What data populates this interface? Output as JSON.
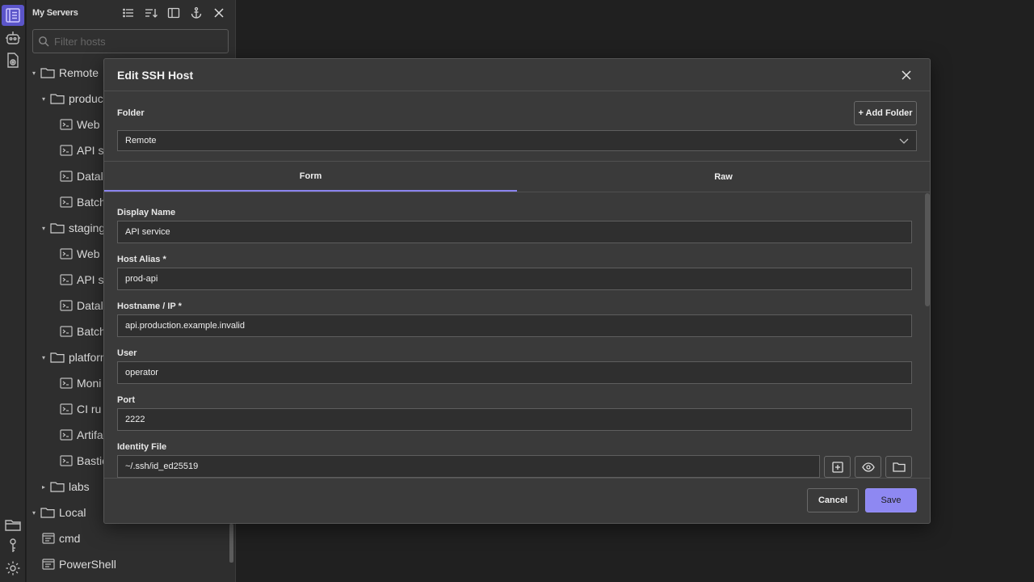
{
  "sidebar": {
    "title": "My Servers",
    "filter_placeholder": "Filter hosts",
    "tree": [
      {
        "label": "Remote",
        "kind": "folder",
        "expanded": true,
        "depth": 0
      },
      {
        "label": "production",
        "kind": "folder",
        "expanded": true,
        "depth": 1
      },
      {
        "label": "Web",
        "kind": "host",
        "depth": 2
      },
      {
        "label": "API s",
        "kind": "host",
        "depth": 2
      },
      {
        "label": "Datal",
        "kind": "host",
        "depth": 2
      },
      {
        "label": "Batch",
        "kind": "host",
        "depth": 2
      },
      {
        "label": "staging",
        "kind": "folder",
        "expanded": true,
        "depth": 1
      },
      {
        "label": "Web",
        "kind": "host",
        "depth": 2
      },
      {
        "label": "API s",
        "kind": "host",
        "depth": 2
      },
      {
        "label": "Datal",
        "kind": "host",
        "depth": 2
      },
      {
        "label": "Batch",
        "kind": "host",
        "depth": 2
      },
      {
        "label": "platform",
        "kind": "folder",
        "expanded": true,
        "depth": 1
      },
      {
        "label": "Moni",
        "kind": "host",
        "depth": 2
      },
      {
        "label": "CI ru",
        "kind": "host",
        "depth": 2
      },
      {
        "label": "Artifa",
        "kind": "host",
        "depth": 2
      },
      {
        "label": "Bastic",
        "kind": "host",
        "depth": 2
      },
      {
        "label": "labs",
        "kind": "folder",
        "expanded": false,
        "depth": 1
      },
      {
        "label": "Local",
        "kind": "folder",
        "expanded": true,
        "depth": 0
      },
      {
        "label": "cmd",
        "kind": "terminal",
        "depth": 1
      },
      {
        "label": "PowerShell",
        "kind": "terminal",
        "depth": 1
      }
    ]
  },
  "dialog": {
    "title": "Edit SSH Host",
    "folder_label": "Folder",
    "add_folder_label": "+ Add Folder",
    "folder_value": "Remote",
    "tabs": [
      "Form",
      "Raw"
    ],
    "active_tab": "Form",
    "fields": [
      {
        "label": "Display Name",
        "value": "API service"
      },
      {
        "label": "Host Alias *",
        "value": "prod-api"
      },
      {
        "label": "Hostname / IP *",
        "value": "api.production.example.invalid"
      },
      {
        "label": "User",
        "value": "operator"
      },
      {
        "label": "Port",
        "value": "2222"
      },
      {
        "label": "Identity File",
        "value": "~/.ssh/id_ed25519"
      }
    ],
    "cancel_label": "Cancel",
    "save_label": "Save"
  },
  "colors": {
    "accent": "#8e88f2",
    "activity_active": "#5b55c9"
  }
}
